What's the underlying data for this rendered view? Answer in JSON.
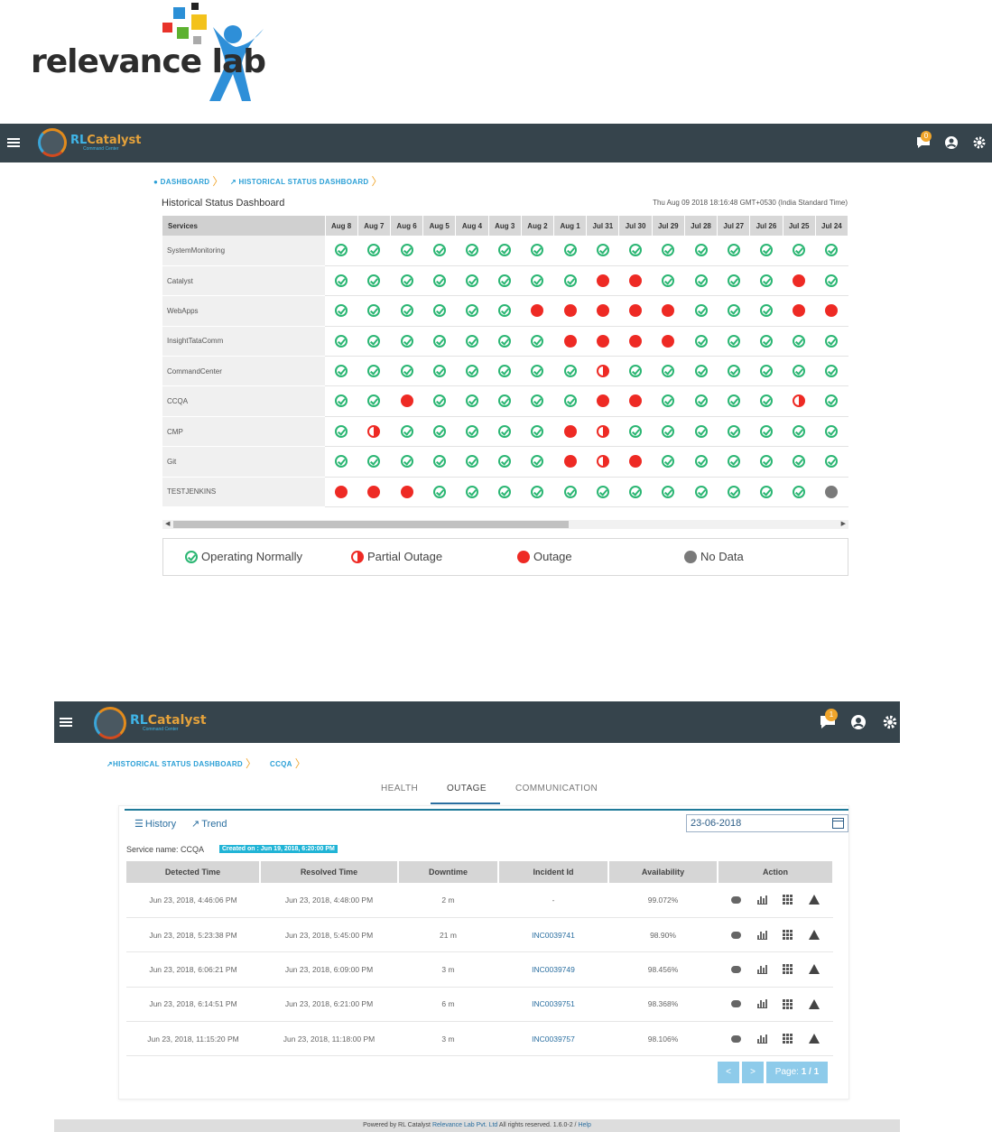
{
  "logo": {
    "text": "relevance lab"
  },
  "brand": {
    "name_a": "RL",
    "name_b": "Catalyst",
    "tagline": "Command Center"
  },
  "nav_top": {
    "notifications_count": "0"
  },
  "nav_bottom": {
    "notifications_count": "1"
  },
  "breadcrumb_top": {
    "item1": "DASHBOARD",
    "item2": "HISTORICAL STATUS DASHBOARD"
  },
  "history": {
    "title": "Historical Status Dashboard",
    "timestamp": "Thu Aug 09 2018 18:16:48 GMT+0530 (India Standard Time)",
    "services_header": "Services",
    "dates": [
      "Aug 8",
      "Aug 7",
      "Aug 6",
      "Aug 5",
      "Aug 4",
      "Aug 3",
      "Aug 2",
      "Aug 1",
      "Jul 31",
      "Jul 30",
      "Jul 29",
      "Jul 28",
      "Jul 27",
      "Jul 26",
      "Jul 25",
      "Jul 24"
    ],
    "rows": [
      {
        "service": "SystemMonitoring",
        "status": [
          "ok",
          "ok",
          "ok",
          "ok",
          "ok",
          "ok",
          "ok",
          "ok",
          "ok",
          "ok",
          "ok",
          "ok",
          "ok",
          "ok",
          "ok",
          "ok"
        ]
      },
      {
        "service": "Catalyst",
        "status": [
          "ok",
          "ok",
          "ok",
          "ok",
          "ok",
          "ok",
          "ok",
          "ok",
          "out",
          "out",
          "ok",
          "ok",
          "ok",
          "ok",
          "out",
          "ok"
        ]
      },
      {
        "service": "WebApps",
        "status": [
          "ok",
          "ok",
          "ok",
          "ok",
          "ok",
          "ok",
          "out",
          "out",
          "out",
          "out",
          "out",
          "ok",
          "ok",
          "ok",
          "out",
          "out"
        ]
      },
      {
        "service": "InsightTataComm",
        "status": [
          "ok",
          "ok",
          "ok",
          "ok",
          "ok",
          "ok",
          "ok",
          "out",
          "out",
          "out",
          "out",
          "ok",
          "ok",
          "ok",
          "ok",
          "ok"
        ]
      },
      {
        "service": "CommandCenter",
        "status": [
          "ok",
          "ok",
          "ok",
          "ok",
          "ok",
          "ok",
          "ok",
          "ok",
          "part",
          "ok",
          "ok",
          "ok",
          "ok",
          "ok",
          "ok",
          "ok"
        ]
      },
      {
        "service": "CCQA",
        "status": [
          "ok",
          "ok",
          "out",
          "ok",
          "ok",
          "ok",
          "ok",
          "ok",
          "out",
          "out",
          "ok",
          "ok",
          "ok",
          "ok",
          "part",
          "ok"
        ]
      },
      {
        "service": "CMP",
        "status": [
          "ok",
          "part",
          "ok",
          "ok",
          "ok",
          "ok",
          "ok",
          "out",
          "part",
          "ok",
          "ok",
          "ok",
          "ok",
          "ok",
          "ok",
          "ok"
        ]
      },
      {
        "service": "Git",
        "status": [
          "ok",
          "ok",
          "ok",
          "ok",
          "ok",
          "ok",
          "ok",
          "out",
          "part",
          "out",
          "ok",
          "ok",
          "ok",
          "ok",
          "ok",
          "ok"
        ]
      },
      {
        "service": "TESTJENKINS",
        "status": [
          "out",
          "out",
          "out",
          "ok",
          "ok",
          "ok",
          "ok",
          "ok",
          "ok",
          "ok",
          "ok",
          "ok",
          "ok",
          "ok",
          "ok",
          "nd"
        ]
      }
    ],
    "legend": {
      "ok": "Operating Normally",
      "part": "Partial Outage",
      "out": "Outage",
      "nd": "No Data"
    },
    "colors": {
      "ok": "#2bb673",
      "out": "#ee2a24",
      "nd": "#7a7a7a"
    }
  },
  "breadcrumb_bottom": {
    "item1": "HISTORICAL STATUS DASHBOARD",
    "item2": "CCQA"
  },
  "tabs": {
    "health": "HEALTH",
    "outage": "OUTAGE",
    "communication": "COMMUNICATION"
  },
  "subtabs": {
    "history": "History",
    "trend": "Trend"
  },
  "date_value": "23-06-2018",
  "service_info": {
    "label": "Service name: CCQA",
    "created": "Created on : Jun 19, 2018, 6:20:00 PM"
  },
  "incidents": {
    "headers": {
      "detected": "Detected Time",
      "resolved": "Resolved Time",
      "downtime": "Downtime",
      "incident": "Incident Id",
      "availability": "Availability",
      "action": "Action"
    },
    "rows": [
      {
        "detected": "Jun 23, 2018, 4:46:06 PM",
        "resolved": "Jun 23, 2018, 4:48:00 PM",
        "downtime": "2 m",
        "incident": "-",
        "availability": "99.072%"
      },
      {
        "detected": "Jun 23, 2018, 5:23:38 PM",
        "resolved": "Jun 23, 2018, 5:45:00 PM",
        "downtime": "21 m",
        "incident": "INC0039741",
        "availability": "98.90%"
      },
      {
        "detected": "Jun 23, 2018, 6:06:21 PM",
        "resolved": "Jun 23, 2018, 6:09:00 PM",
        "downtime": "3 m",
        "incident": "INC0039749",
        "availability": "98.456%"
      },
      {
        "detected": "Jun 23, 2018, 6:14:51 PM",
        "resolved": "Jun 23, 2018, 6:21:00 PM",
        "downtime": "6 m",
        "incident": "INC0039751",
        "availability": "98.368%"
      },
      {
        "detected": "Jun 23, 2018, 11:15:20 PM",
        "resolved": "Jun 23, 2018, 11:18:00 PM",
        "downtime": "3 m",
        "incident": "INC0039757",
        "availability": "98.106%"
      }
    ]
  },
  "pagination": {
    "prev": "<",
    "next": ">",
    "page_label": "Page: ",
    "page_value": "1 / 1"
  },
  "footer": {
    "prefix": "Powered by RL Catalyst",
    "company": "Relevance Lab Pvt. Ltd",
    "rights": "All rights reserved. 1.6.0-2 /",
    "help": "Help"
  }
}
